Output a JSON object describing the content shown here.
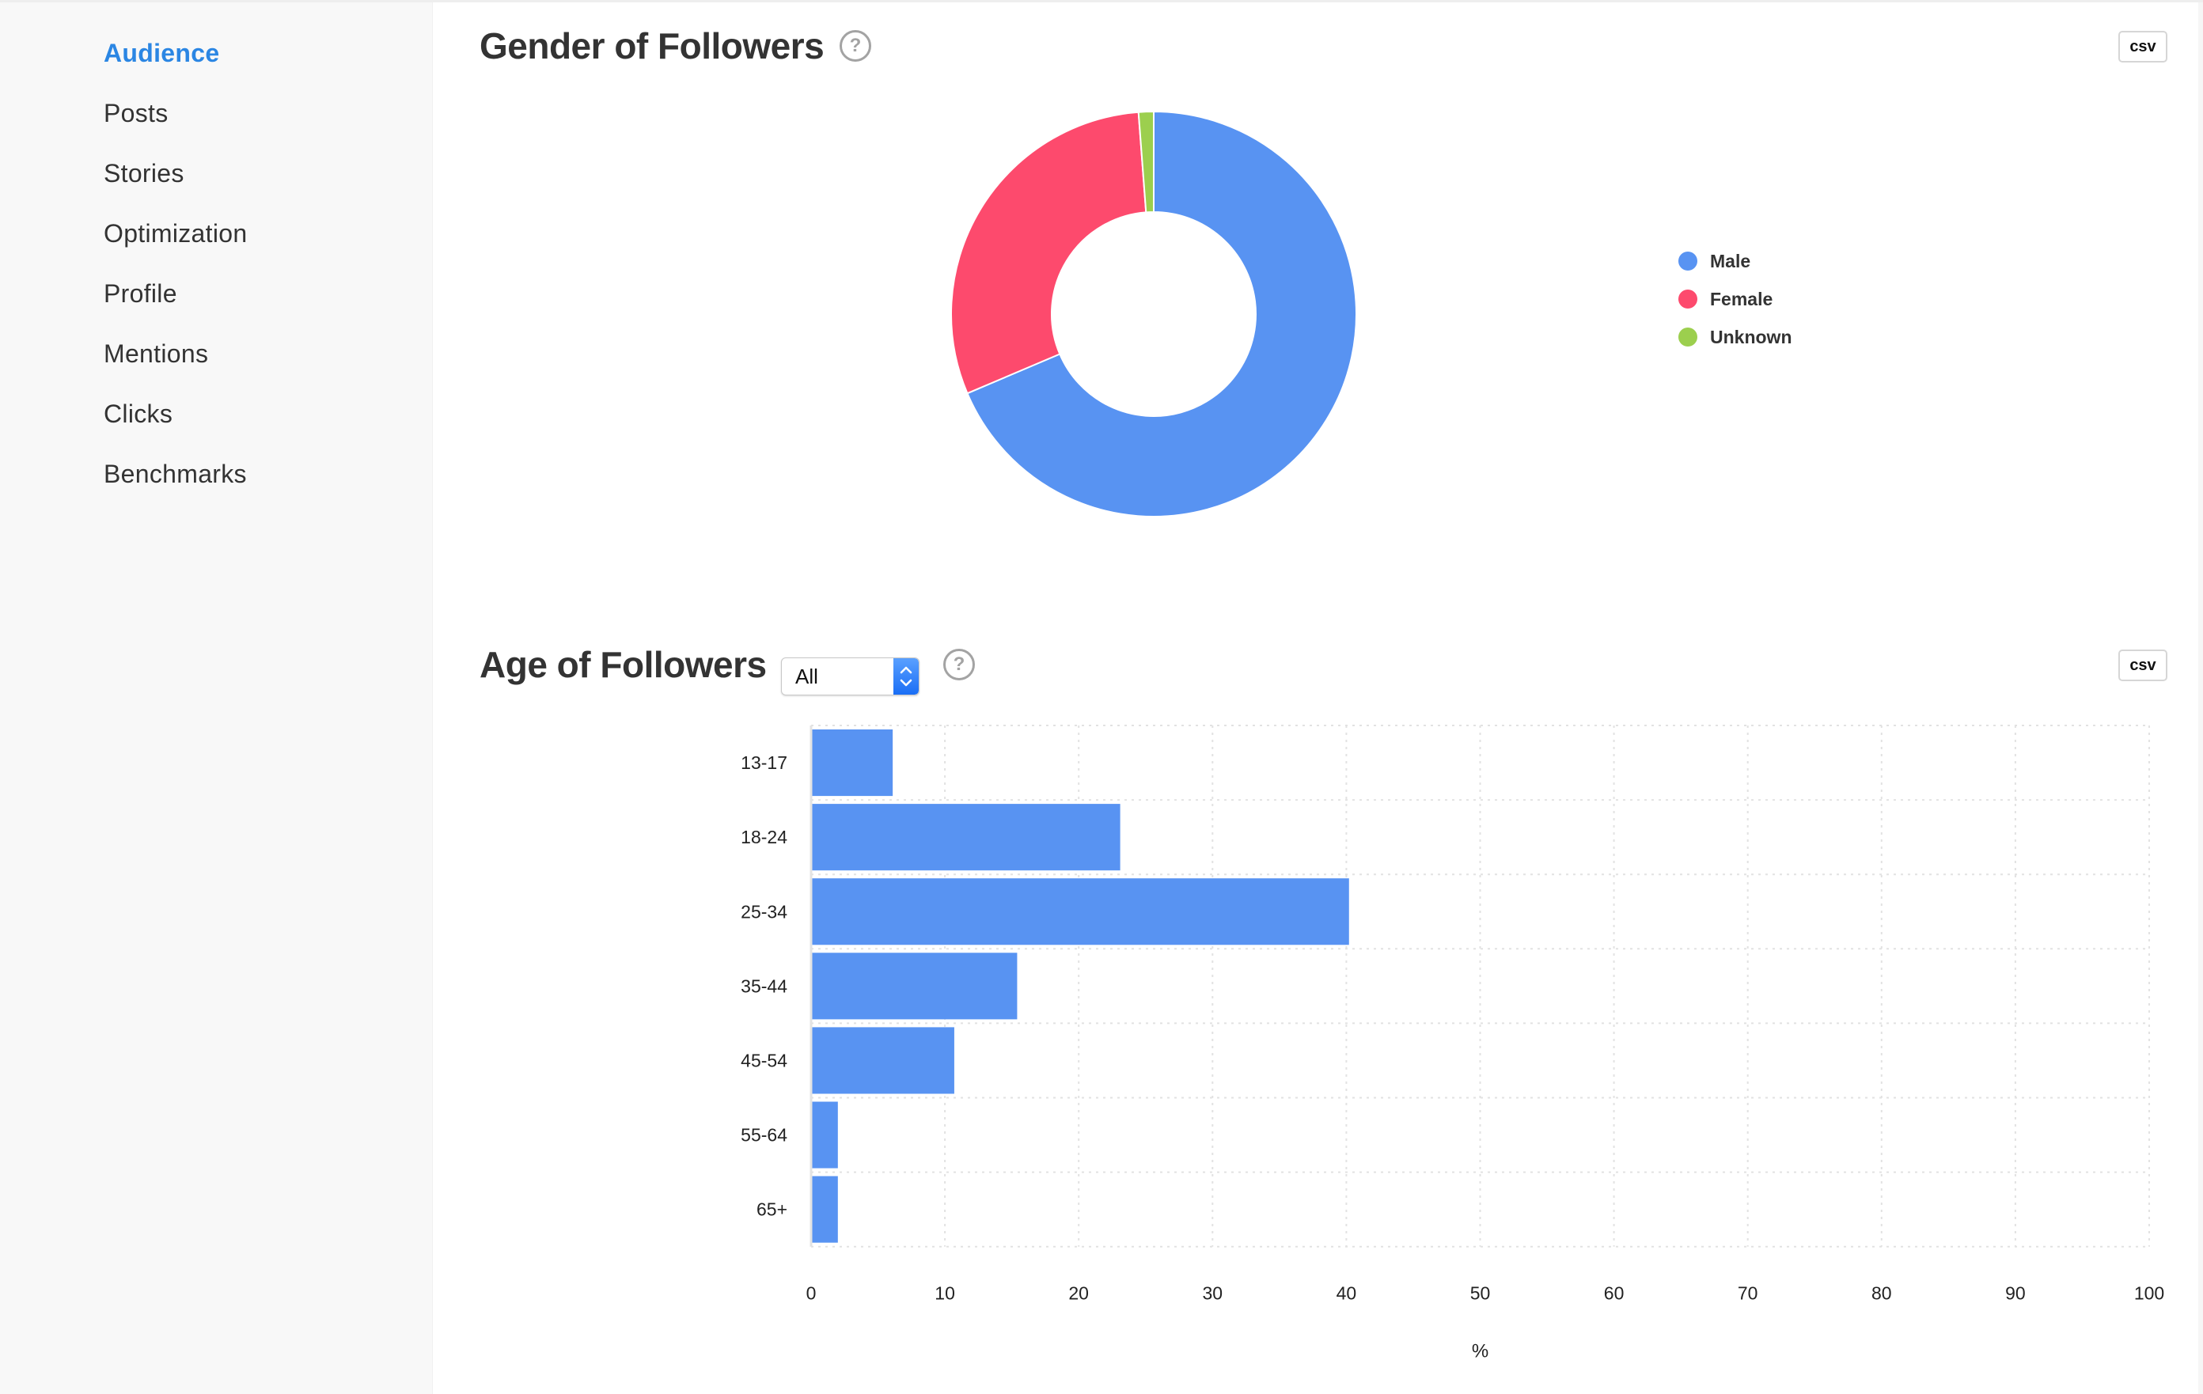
{
  "sidebar": {
    "items": [
      {
        "label": "Audience",
        "active": true
      },
      {
        "label": "Posts",
        "active": false
      },
      {
        "label": "Stories",
        "active": false
      },
      {
        "label": "Optimization",
        "active": false
      },
      {
        "label": "Profile",
        "active": false
      },
      {
        "label": "Mentions",
        "active": false
      },
      {
        "label": "Clicks",
        "active": false
      },
      {
        "label": "Benchmarks",
        "active": false
      }
    ]
  },
  "colors": {
    "accent": "#2b86e3",
    "male": "#5893f2",
    "female": "#fd4a6d",
    "unknown": "#9ccf4e",
    "bar": "#5893f2",
    "select_blue": "#1a6ef5"
  },
  "gender_section": {
    "title": "Gender of Followers",
    "help_icon": "?",
    "csv_label": "csv"
  },
  "age_section": {
    "title": "Age of Followers",
    "filter_value": "All",
    "help_icon": "?",
    "csv_label": "csv"
  },
  "chart_data": [
    {
      "type": "pie",
      "variant": "donut",
      "title": "Gender of Followers",
      "categories": [
        "Male",
        "Female",
        "Unknown"
      ],
      "values": [
        68.6,
        30.2,
        1.2
      ],
      "unit": "%",
      "legend": "right"
    },
    {
      "type": "bar",
      "orientation": "horizontal",
      "title": "Age of Followers",
      "categories": [
        "13-17",
        "18-24",
        "25-34",
        "35-44",
        "45-54",
        "55-64",
        "65+"
      ],
      "values": [
        6.1,
        23.1,
        40.2,
        15.4,
        10.7,
        2.0,
        2.0
      ],
      "xlabel": "%",
      "ylabel": "",
      "xlim": [
        0,
        100
      ],
      "xticks": [
        "0",
        "10",
        "20",
        "30",
        "40",
        "50",
        "60",
        "70",
        "80",
        "90",
        "100"
      ],
      "grid": true
    }
  ]
}
